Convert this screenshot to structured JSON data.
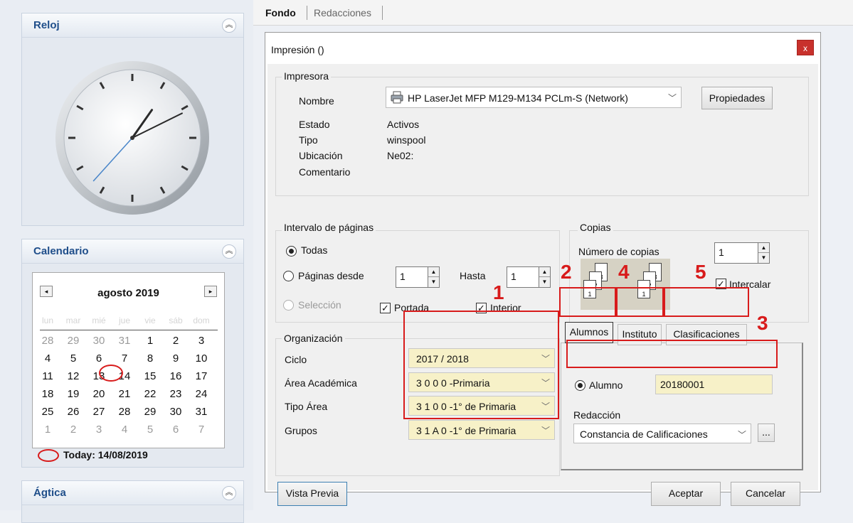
{
  "sidebar": {
    "clock": {
      "title": "Reloj",
      "time": {
        "hour": 1,
        "minute": 10,
        "second": 37
      }
    },
    "calendar": {
      "title": "Calendario",
      "month": "agosto 2019",
      "weekdays": [
        "lun",
        "mar",
        "mié",
        "jue",
        "vie",
        "sáb",
        "dom"
      ],
      "weeks": [
        [
          "28",
          "29",
          "30",
          "31",
          "1",
          "2",
          "3"
        ],
        [
          "4",
          "5",
          "6",
          "7",
          "8",
          "9",
          "10"
        ],
        [
          "11",
          "12",
          "13",
          "14",
          "15",
          "16",
          "17"
        ],
        [
          "18",
          "19",
          "20",
          "21",
          "22",
          "23",
          "24"
        ],
        [
          "25",
          "26",
          "27",
          "28",
          "29",
          "30",
          "31"
        ],
        [
          "1",
          "2",
          "3",
          "4",
          "5",
          "6",
          "7"
        ]
      ],
      "today_label": "Today: 14/08/2019"
    },
    "agtica": {
      "title": "Ágtica"
    }
  },
  "tabs": [
    "Fondo",
    "Redacciones"
  ],
  "dialog": {
    "title": "Impresión ()",
    "close": "x",
    "printer": {
      "group": "Impresora",
      "name_label": "Nombre",
      "name_value": "HP LaserJet MFP M129-M134 PCLm-S (Network)",
      "properties": "Propiedades",
      "status_label": "Estado",
      "status_value": "Activos",
      "type_label": "Tipo",
      "type_value": "winspool",
      "location_label": "Ubicación",
      "location_value": "Ne02:",
      "comment_label": "Comentario"
    },
    "range": {
      "group": "Intervalo de páginas",
      "all": "Todas",
      "pages_from": "Páginas desde",
      "from_value": "1",
      "to_label": "Hasta",
      "to_value": "1",
      "selection": "Selección",
      "cover": "Portada",
      "interior": "Interior"
    },
    "copies": {
      "group": "Copias",
      "count_label": "Número de copias",
      "count_value": "1",
      "collate": "Intercalar"
    },
    "organization": {
      "group": "Organización",
      "fields": [
        {
          "label": "Ciclo",
          "value": "2017 / 2018"
        },
        {
          "label": "Área Académica",
          "value": "3 0 0 0 -Primaria"
        },
        {
          "label": "Tipo Área",
          "value": "3 1 0 0 -1° de Primaria"
        },
        {
          "label": "Grupos",
          "value": "3 1 A 0 -1° de Primaria"
        }
      ]
    },
    "subtabs": [
      "Alumnos",
      "Instituto",
      "Clasificaciones"
    ],
    "student": {
      "radio_label": "Alumno",
      "value": "20180001",
      "redaction_label": "Redacción",
      "redaction_value": "Constancia de Calificaciones",
      "more": "..."
    },
    "buttons": {
      "preview": "Vista Previa",
      "accept": "Aceptar",
      "cancel": "Cancelar"
    }
  },
  "annotations": [
    "1",
    "2",
    "3",
    "4",
    "5"
  ],
  "colors": {
    "annotation_red": "#d81b1b",
    "dialog_bg": "#f0f0f0",
    "combo_yellow": "#f7f1c8",
    "sidebar_title": "#1f4e8a"
  }
}
